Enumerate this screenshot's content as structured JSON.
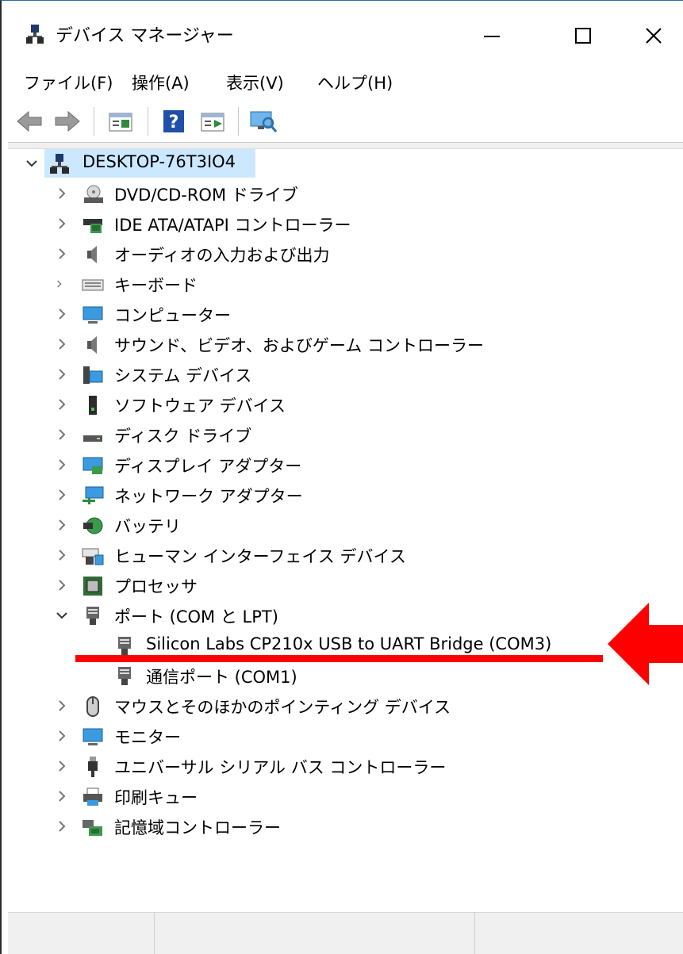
{
  "window": {
    "title": "デバイス マネージャー"
  },
  "menu": [
    "ファイル(F)",
    "操作(A)",
    "表示(V)",
    "ヘルプ(H)"
  ],
  "toolbar": [
    "back-icon",
    "forward-icon",
    "properties-icon",
    "help-icon",
    "update-driver-icon",
    "scan-hardware-icon"
  ],
  "tree": {
    "root": "DESKTOP-76T3IO4",
    "categories": [
      "DVD/CD-ROM ドライブ",
      "IDE ATA/ATAPI コントローラー",
      "オーディオの入力および出力",
      "キーボード",
      "コンピューター",
      "サウンド、ビデオ、およびゲーム コントローラー",
      "システム デバイス",
      "ソフトウェア デバイス",
      "ディスク ドライブ",
      "ディスプレイ アダプター",
      "ネットワーク アダプター",
      "バッテリ",
      "ヒューマン インターフェイス デバイス",
      "プロセッサ",
      "ポート (COM と LPT)",
      "マウスとそのほかのポインティング デバイス",
      "モニター",
      "ユニバーサル シリアル バス コントローラー",
      "印刷キュー",
      "記憶域コントローラー"
    ],
    "ports": [
      "Silicon Labs CP210x USB to UART Bridge (COM3)",
      "通信ポート (COM1)"
    ]
  },
  "colors": {
    "selection": "#cce8ff",
    "annotation": "#ff0000"
  }
}
